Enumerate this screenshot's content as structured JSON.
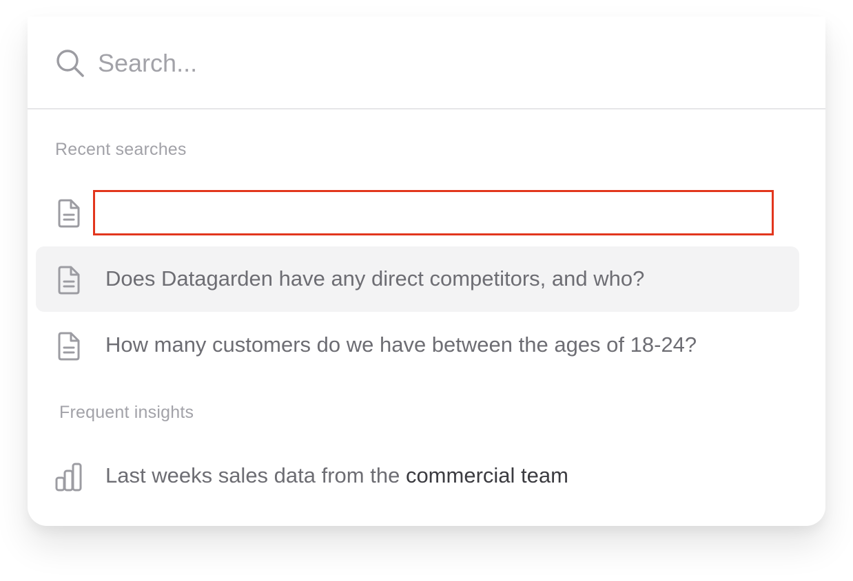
{
  "search": {
    "value": "",
    "placeholder": "Search..."
  },
  "recent": {
    "label": "Recent searches",
    "items": [
      {
        "text": "",
        "icon": "document-icon",
        "editing": true
      },
      {
        "text": "Does Datagarden have any direct competitors, and who?",
        "icon": "document-icon",
        "highlighted": true
      },
      {
        "text": "How many customers do we have between the ages of 18-24?",
        "icon": "document-icon"
      }
    ]
  },
  "frequent": {
    "label": "Frequent insights",
    "items": [
      {
        "text_before": "Last weeks sales data from the ",
        "text_emphasis": "commercial team",
        "icon": "bar-chart-icon"
      }
    ]
  },
  "colors": {
    "highlight_bg": "#f3f3f4",
    "edit_border": "#e2361d",
    "muted_text": "#a2a2a8",
    "body_text": "#6d6d73"
  }
}
